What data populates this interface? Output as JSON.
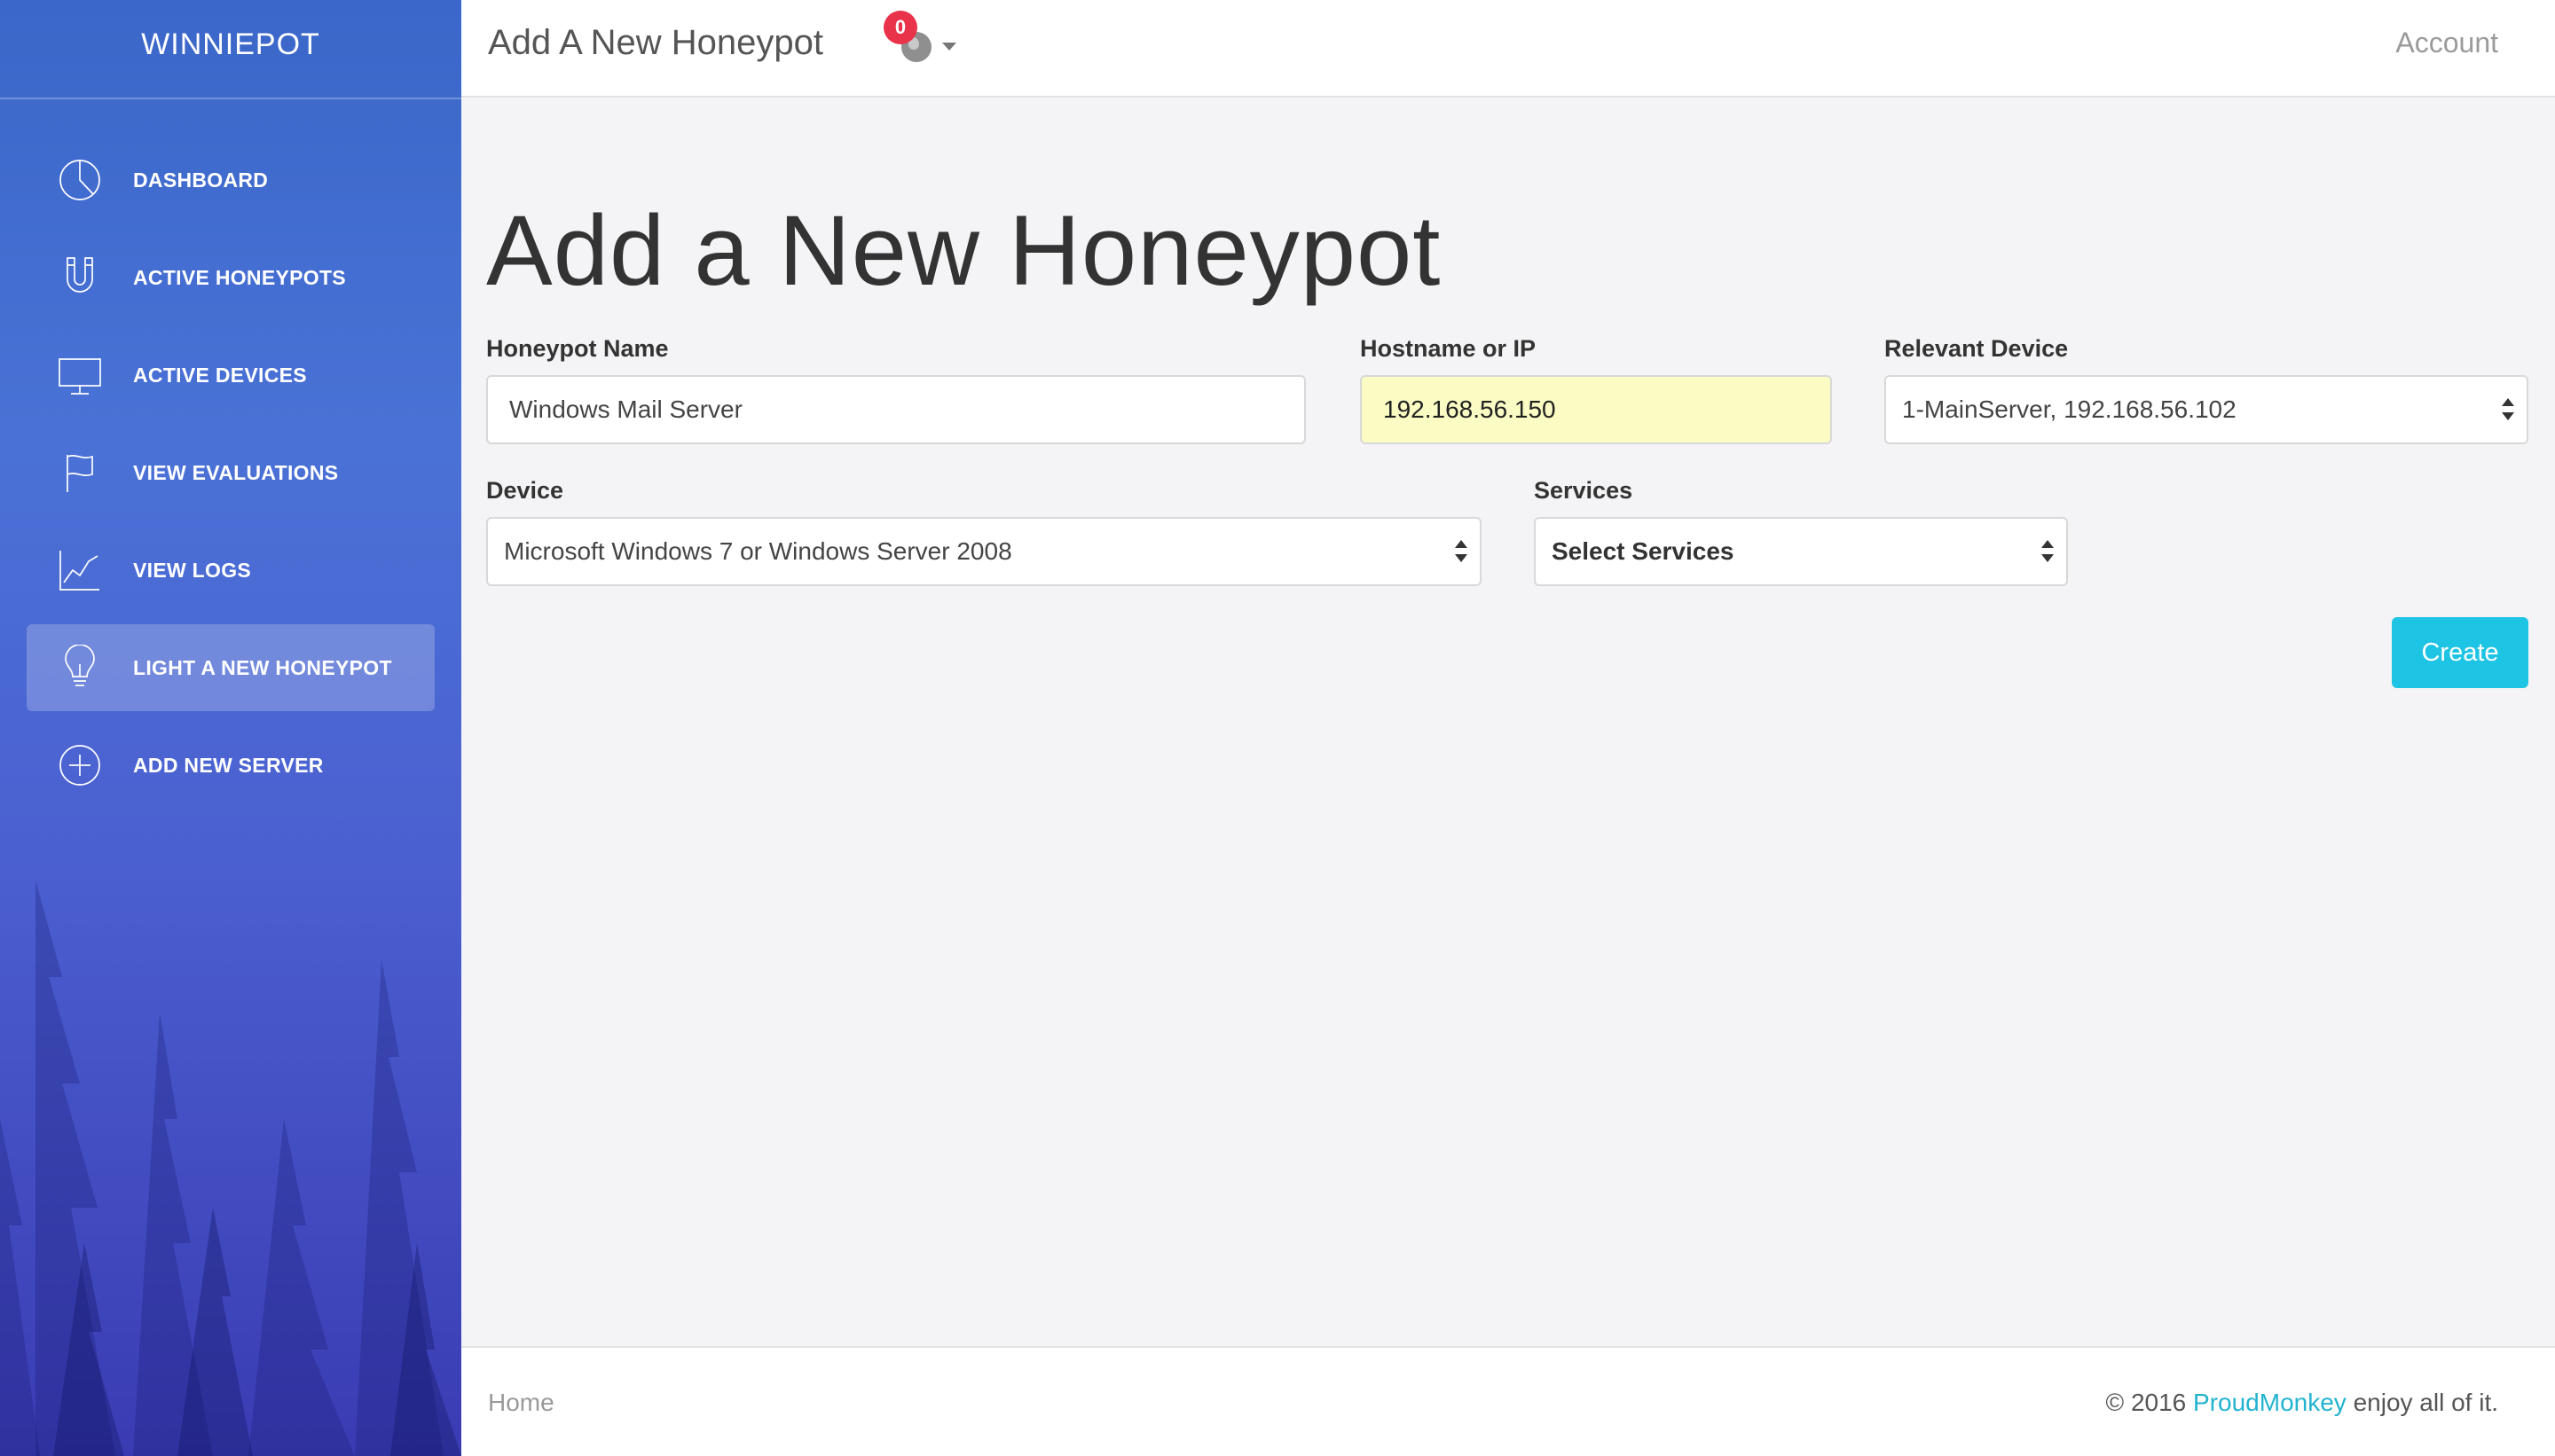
{
  "sidebar": {
    "brand": "WINNIEPOT",
    "items": [
      {
        "label": "DASHBOARD",
        "icon": "pie-chart-icon"
      },
      {
        "label": "ACTIVE HONEYPOTS",
        "icon": "magnet-icon"
      },
      {
        "label": "ACTIVE DEVICES",
        "icon": "monitor-icon"
      },
      {
        "label": "VIEW EVALUATIONS",
        "icon": "flag-icon"
      },
      {
        "label": "VIEW LOGS",
        "icon": "line-chart-icon"
      },
      {
        "label": "LIGHT A NEW HONEYPOT",
        "icon": "lightbulb-icon",
        "active": true
      },
      {
        "label": "ADD NEW SERVER",
        "icon": "plus-circle-icon"
      }
    ]
  },
  "topbar": {
    "title": "Add A New Honeypot",
    "notification_count": "0",
    "notification_icon": "globe-icon",
    "account_label": "Account"
  },
  "main": {
    "heading": "Add a New Honeypot",
    "fields": {
      "honeypot_name": {
        "label": "Honeypot Name",
        "value": "Windows Mail Server"
      },
      "hostname": {
        "label": "Hostname or IP",
        "value": "192.168.56.150"
      },
      "relevant_device": {
        "label": "Relevant Device",
        "value": "1-MainServer, 192.168.56.102"
      },
      "device": {
        "label": "Device",
        "value": "Microsoft Windows 7 or Windows Server 2008"
      },
      "services": {
        "label": "Services",
        "value": "Select Services"
      }
    },
    "create_label": "Create"
  },
  "footer": {
    "home_label": "Home",
    "copyright_prefix": "© 2016",
    "company": "ProudMonkey",
    "copyright_suffix": "enjoy all of it."
  },
  "colors": {
    "accent": "#1ec4e4",
    "badge": "#e8334b",
    "sidebar_top": "#3a67c9",
    "sidebar_bottom": "#3a3bb2",
    "highlight_field": "#fafcc3"
  }
}
